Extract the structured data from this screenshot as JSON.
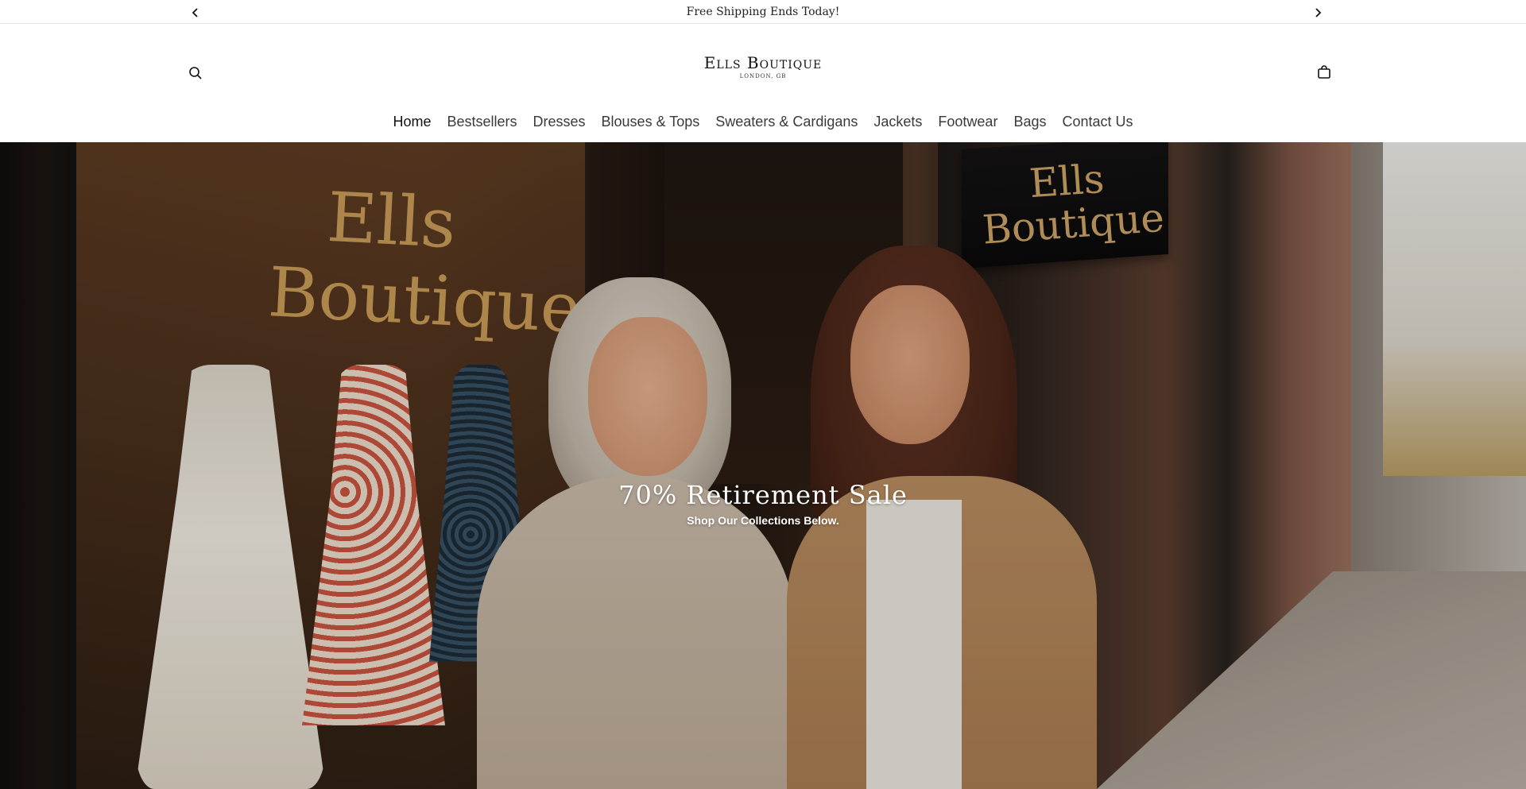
{
  "announcement": {
    "text": "Free Shipping Ends Today!",
    "prev_icon": "chevron-left-icon",
    "next_icon": "chevron-right-icon"
  },
  "header": {
    "logo_main": "Ells Boutique",
    "logo_sub": "LONDON, GB",
    "search_icon": "search-icon",
    "cart_icon": "shopping-bag-icon"
  },
  "nav": {
    "items": [
      {
        "label": "Home",
        "active": true
      },
      {
        "label": "Bestsellers"
      },
      {
        "label": "Dresses"
      },
      {
        "label": "Blouses & Tops"
      },
      {
        "label": "Sweaters & Cardigans"
      },
      {
        "label": "Jackets"
      },
      {
        "label": "Footwear"
      },
      {
        "label": "Bags"
      },
      {
        "label": "Contact Us"
      }
    ]
  },
  "hero": {
    "window_sign": "Ells Boutique",
    "hanging_sign": "Ells Boutique",
    "title": "70% Retirement Sale",
    "subtitle": "Shop Our Collections Below."
  },
  "colors": {
    "text": "#121212",
    "nav_text": "#3a3a3a",
    "sign_gold": "#d2a45c"
  }
}
